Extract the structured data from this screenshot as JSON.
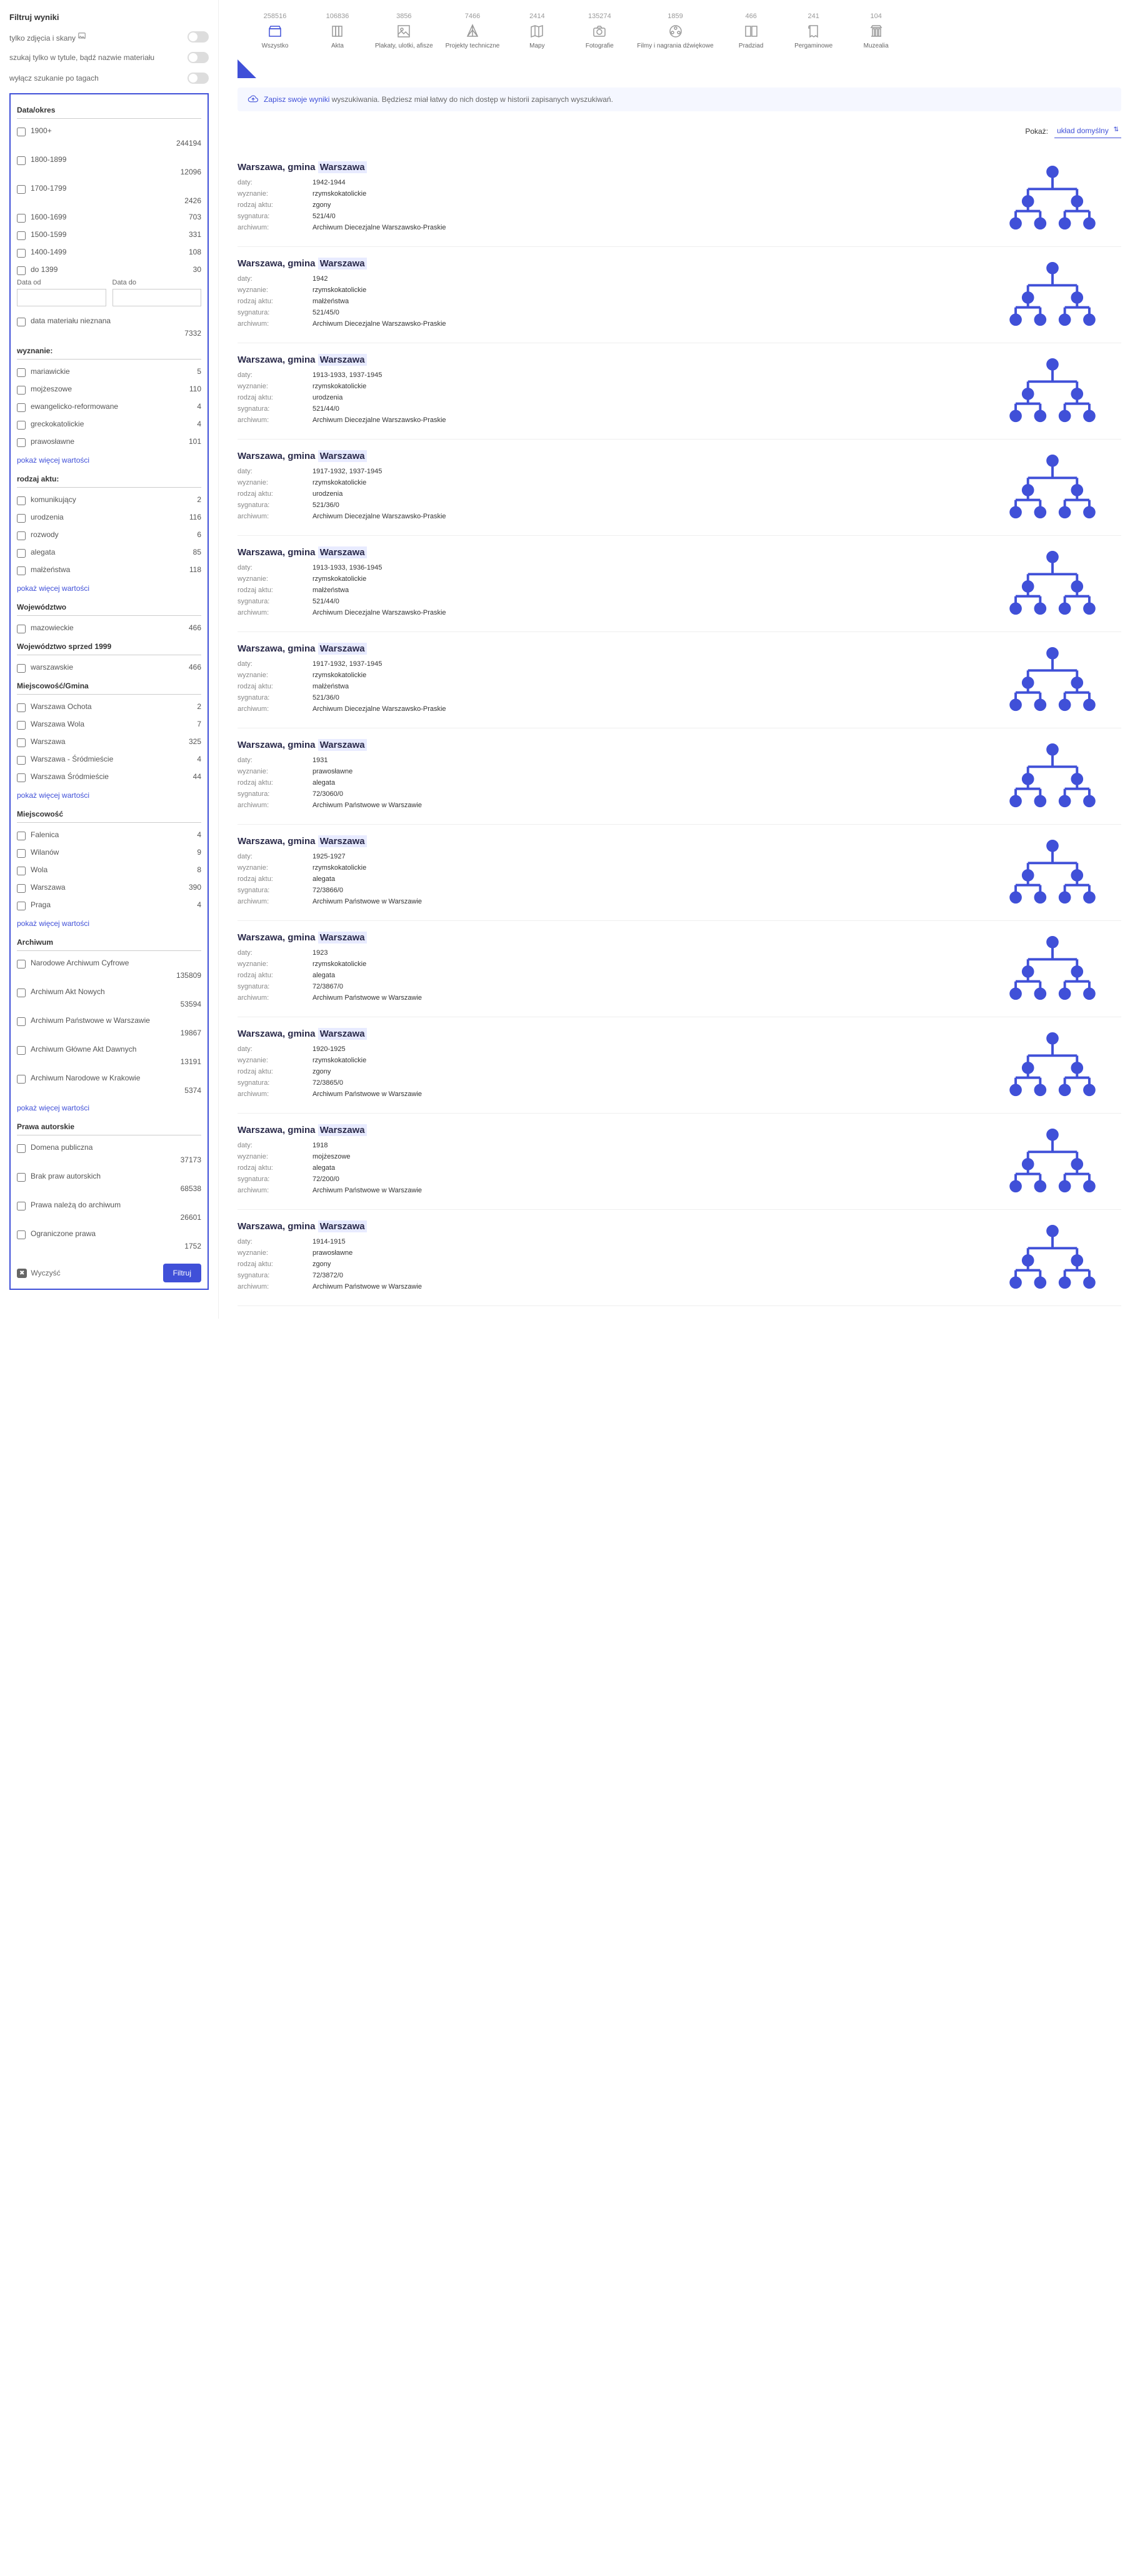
{
  "sidebar": {
    "title": "Filtruj wyniki",
    "toggles": [
      {
        "label": "tylko zdjęcia i skany",
        "icon": true
      },
      {
        "label": "szukaj tylko w tytule, bądź nazwie materiału",
        "icon": false
      },
      {
        "label": "wyłącz szukanie po tagach",
        "icon": false
      }
    ],
    "date_section": {
      "title": "Data/okres",
      "items": [
        {
          "label": "1900+",
          "count": "244194",
          "below": true
        },
        {
          "label": "1800-1899",
          "count": "12096",
          "below": true
        },
        {
          "label": "1700-1799",
          "count": "2426",
          "below": true
        },
        {
          "label": "1600-1699",
          "count": "703"
        },
        {
          "label": "1500-1599",
          "count": "331"
        },
        {
          "label": "1400-1499",
          "count": "108"
        },
        {
          "label": "do 1399",
          "count": "30"
        }
      ],
      "from_label": "Data od",
      "to_label": "Data do",
      "unknown": {
        "label": "data materiału nieznana",
        "count": "7332",
        "below": true
      }
    },
    "sections": [
      {
        "title": "wyznanie:",
        "items": [
          {
            "label": "mariawickie",
            "count": "5"
          },
          {
            "label": "mojżeszowe",
            "count": "110"
          },
          {
            "label": "ewangelicko-reformowane",
            "count": "4"
          },
          {
            "label": "greckokatolickie",
            "count": "4"
          },
          {
            "label": "prawosławne",
            "count": "101"
          }
        ],
        "show_more": "pokaż więcej wartości"
      },
      {
        "title": "rodzaj aktu:",
        "items": [
          {
            "label": "komunikujący",
            "count": "2"
          },
          {
            "label": "urodzenia",
            "count": "116"
          },
          {
            "label": "rozwody",
            "count": "6"
          },
          {
            "label": "alegata",
            "count": "85"
          },
          {
            "label": "małżeństwa",
            "count": "118"
          }
        ],
        "show_more": "pokaż więcej wartości"
      },
      {
        "title": "Województwo",
        "items": [
          {
            "label": "mazowieckie",
            "count": "466"
          }
        ]
      },
      {
        "title": "Województwo sprzed 1999",
        "items": [
          {
            "label": "warszawskie",
            "count": "466"
          }
        ]
      },
      {
        "title": "Miejscowość/Gmina",
        "items": [
          {
            "label": "Warszawa Ochota",
            "count": "2"
          },
          {
            "label": "Warszawa Wola",
            "count": "7"
          },
          {
            "label": "Warszawa",
            "count": "325"
          },
          {
            "label": "Warszawa - Śródmieście",
            "count": "4"
          },
          {
            "label": "Warszawa Śródmieście",
            "count": "44"
          }
        ],
        "show_more": "pokaż więcej wartości"
      },
      {
        "title": "Miejscowość",
        "items": [
          {
            "label": "Falenica",
            "count": "4"
          },
          {
            "label": "Wilanów",
            "count": "9"
          },
          {
            "label": "Wola",
            "count": "8"
          },
          {
            "label": "Warszawa",
            "count": "390"
          },
          {
            "label": "Praga",
            "count": "4"
          }
        ],
        "show_more": "pokaż więcej wartości"
      },
      {
        "title": "Archiwum",
        "items": [
          {
            "label": "Narodowe Archiwum Cyfrowe",
            "count": "135809",
            "below": true
          },
          {
            "label": "Archiwum Akt Nowych",
            "count": "53594",
            "below": true
          },
          {
            "label": "Archiwum Państwowe w Warszawie",
            "count": "19867",
            "below": true
          },
          {
            "label": "Archiwum Główne Akt Dawnych",
            "count": "13191",
            "below": true
          },
          {
            "label": "Archiwum Narodowe w Krakowie",
            "count": "5374",
            "below": true
          }
        ],
        "show_more": "pokaż więcej wartości"
      },
      {
        "title": "Prawa autorskie",
        "items": [
          {
            "label": "Domena publiczna",
            "count": "37173",
            "below": true
          },
          {
            "label": "Brak praw autorskich",
            "count": "68538",
            "below": true
          },
          {
            "label": "Prawa należą do archiwum",
            "count": "26601",
            "below": true
          },
          {
            "label": "Ograniczone prawa",
            "count": "1752",
            "below": true
          }
        ]
      }
    ],
    "clear": "Wyczyść",
    "apply": "Filtruj"
  },
  "categories": [
    {
      "count": "258516",
      "name": "Wszystko",
      "icon": "box"
    },
    {
      "count": "106836",
      "name": "Akta",
      "icon": "books"
    },
    {
      "count": "3856",
      "name": "Plakaty, ulotki, afisze",
      "icon": "image"
    },
    {
      "count": "7466",
      "name": "Projekty techniczne",
      "icon": "compass"
    },
    {
      "count": "2414",
      "name": "Mapy",
      "icon": "map"
    },
    {
      "count": "135274",
      "name": "Fotografie",
      "icon": "camera"
    },
    {
      "count": "1859",
      "name": "Filmy i nagrania dźwiękowe",
      "icon": "film"
    },
    {
      "count": "466",
      "name": "Pradziad",
      "icon": "book-open"
    },
    {
      "count": "241",
      "name": "Pergaminowe",
      "icon": "scroll"
    },
    {
      "count": "104",
      "name": "Muzealia",
      "icon": "column"
    }
  ],
  "save_bar": {
    "link": "Zapisz swoje wyniki",
    "text": " wyszukiwania. Będziesz miał łatwy do nich dostęp w historii zapisanych wyszukiwań."
  },
  "sort": {
    "label": "Pokaż:",
    "value": "układ domyślny"
  },
  "meta_labels": {
    "daty": "daty:",
    "wyznanie": "wyznanie:",
    "rodzaj": "rodzaj aktu:",
    "sygnatura": "sygnatura:",
    "archiwum": "archiwum:"
  },
  "results": [
    {
      "title_pre": "Warszawa, gmina ",
      "title_hl": "Warszawa",
      "daty": "1942-1944",
      "wyznanie": "rzymskokatolickie",
      "rodzaj": "zgony",
      "sygnatura": "521/4/0",
      "archiwum": "Archiwum Diecezjalne Warszawsko-Praskie"
    },
    {
      "title_pre": "Warszawa, gmina ",
      "title_hl": "Warszawa",
      "daty": "1942",
      "wyznanie": "rzymskokatolickie",
      "rodzaj": "małżeństwa",
      "sygnatura": "521/45/0",
      "archiwum": "Archiwum Diecezjalne Warszawsko-Praskie"
    },
    {
      "title_pre": "Warszawa, gmina ",
      "title_hl": "Warszawa",
      "daty": "1913-1933, 1937-1945",
      "wyznanie": "rzymskokatolickie",
      "rodzaj": "urodzenia",
      "sygnatura": "521/44/0",
      "archiwum": "Archiwum Diecezjalne Warszawsko-Praskie"
    },
    {
      "title_pre": "Warszawa, gmina ",
      "title_hl": "Warszawa",
      "daty": "1917-1932, 1937-1945",
      "wyznanie": "rzymskokatolickie",
      "rodzaj": "urodzenia",
      "sygnatura": "521/36/0",
      "archiwum": "Archiwum Diecezjalne Warszawsko-Praskie"
    },
    {
      "title_pre": "Warszawa, gmina ",
      "title_hl": "Warszawa",
      "daty": "1913-1933, 1936-1945",
      "wyznanie": "rzymskokatolickie",
      "rodzaj": "małżeństwa",
      "sygnatura": "521/44/0",
      "archiwum": "Archiwum Diecezjalne Warszawsko-Praskie"
    },
    {
      "title_pre": "Warszawa, gmina ",
      "title_hl": "Warszawa",
      "daty": "1917-1932, 1937-1945",
      "wyznanie": "rzymskokatolickie",
      "rodzaj": "małżeństwa",
      "sygnatura": "521/36/0",
      "archiwum": "Archiwum Diecezjalne Warszawsko-Praskie"
    },
    {
      "title_pre": "Warszawa, gmina ",
      "title_hl": "Warszawa",
      "daty": "1931",
      "wyznanie": "prawosławne",
      "rodzaj": "alegata",
      "sygnatura": "72/3060/0",
      "archiwum": "Archiwum Państwowe w Warszawie"
    },
    {
      "title_pre": "Warszawa, gmina ",
      "title_hl": "Warszawa",
      "daty": "1925-1927",
      "wyznanie": "rzymskokatolickie",
      "rodzaj": "alegata",
      "sygnatura": "72/3866/0",
      "archiwum": "Archiwum Państwowe w Warszawie"
    },
    {
      "title_pre": "Warszawa, gmina ",
      "title_hl": "Warszawa",
      "daty": "1923",
      "wyznanie": "rzymskokatolickie",
      "rodzaj": "alegata",
      "sygnatura": "72/3867/0",
      "archiwum": "Archiwum Państwowe w Warszawie"
    },
    {
      "title_pre": "Warszawa, gmina ",
      "title_hl": "Warszawa",
      "daty": "1920-1925",
      "wyznanie": "rzymskokatolickie",
      "rodzaj": "zgony",
      "sygnatura": "72/3865/0",
      "archiwum": "Archiwum Państwowe w Warszawie"
    },
    {
      "title_pre": "Warszawa, gmina ",
      "title_hl": "Warszawa",
      "daty": "1918",
      "wyznanie": "mojżeszowe",
      "rodzaj": "alegata",
      "sygnatura": "72/200/0",
      "archiwum": "Archiwum Państwowe w Warszawie"
    },
    {
      "title_pre": "Warszawa, gmina ",
      "title_hl": "Warszawa",
      "daty": "1914-1915",
      "wyznanie": "prawosławne",
      "rodzaj": "zgony",
      "sygnatura": "72/3872/0",
      "archiwum": "Archiwum Państwowe w Warszawie"
    }
  ]
}
